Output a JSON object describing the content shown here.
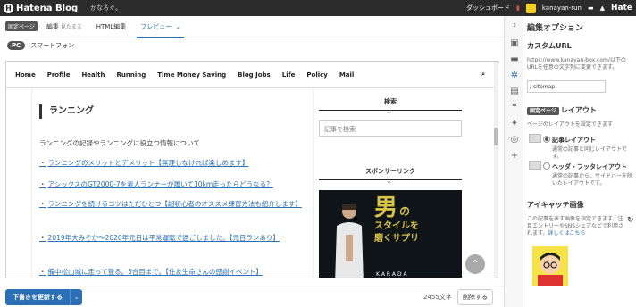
{
  "topbar": {
    "logo": "Hatena Blog",
    "blog_name": "かなろぐ。",
    "dashboard": "ダッシュボード",
    "username": "kanayan-run",
    "hatena": "Hate"
  },
  "tabs": {
    "page_badge": "固定ページ",
    "edit": "編集",
    "edit_small": "見たまま",
    "html": "HTML編集",
    "preview": "プレビュー"
  },
  "device": {
    "pc": "PC",
    "phone": "スマートフォン"
  },
  "preview": {
    "nav": [
      "Home",
      "Profile",
      "Health",
      "Running",
      "Time Money Saving",
      "Blog Jobs",
      "Life",
      "Policy",
      "Mail"
    ],
    "title": "ランニング",
    "description": "ランニングの記録やランニングに役立つ情報について",
    "links": [
      "ランニングのメリットとデメリット【無理しなければ楽しめます】",
      "アシックスのGT2000-7を素人ランナーが履いて10km走ったらどうなる？",
      "ランニングを続けるコツはただひとつ【超初心者のオススメ練習方法も紹介します】",
      "2019年大みそか～2020年元日は平常運転で過ごしました。【元日ランあり】",
      "備中松山城に走って登る。5合目まで。【住友生命さんの感謝イベント】"
    ],
    "sidebar_search_heading": "検索",
    "search_placeholder": "記事を検索",
    "sponsor_heading": "スポンサーリンク",
    "ad_kanji": "男",
    "ad_no": "の",
    "ad_line1": "スタイルを",
    "ad_line2": "磨くサプリ",
    "ad_brand": "KARADA"
  },
  "footer": {
    "update_label": "下書きを更新する",
    "char_count": "2455文字",
    "delete_label": "削除する"
  },
  "side_panel": {
    "title": "編集オプション",
    "custom_url_heading": "カスタムURL",
    "custom_url_desc": "https://www.kanayan-box.com/以下のURLを任意の文字列に変更できます。",
    "url_prefix": "/",
    "url_value": "sitemap",
    "layout_badge": "固定ページ",
    "layout_heading": "レイアウト",
    "layout_desc": "ページのレイアウトを設定できます",
    "opt1_title": "記事レイアウト",
    "opt1_desc": "通常の記事と同じレイアウトです。",
    "opt2_title": "ヘッダ・フッタレイアウト",
    "opt2_desc": "通常の記事から、サイドバーを除いたレイアウトです。",
    "eyecatch_heading": "アイキャッチ画像",
    "eyecatch_desc": "この記事を表す画像を指定できます。注目エントリーやSNSシェアなどで利用されます。",
    "eyecatch_link": "詳しくはこちら"
  }
}
